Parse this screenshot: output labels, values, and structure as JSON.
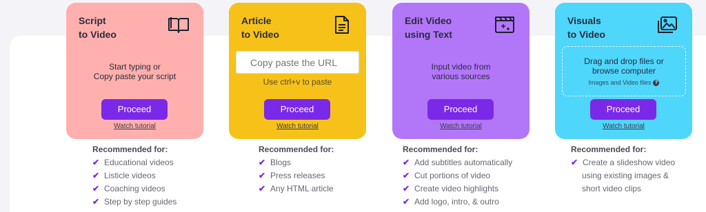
{
  "colors": {
    "card1": "#ffb0ae",
    "card2": "#f6c21a",
    "card3": "#b277f9",
    "card4": "#4fd6fb",
    "accent": "#7b29e8"
  },
  "cards": [
    {
      "title_line1": "Script",
      "title_line2": "to Video",
      "icon": "open-book-icon",
      "desc_line1": "Start typing or",
      "desc_line2": "Copy paste your script",
      "button": "Proceed",
      "tutorial": "Watch tutorial"
    },
    {
      "title_line1": "Article",
      "title_line2": "to Video",
      "icon": "document-icon",
      "input_placeholder": "Copy paste the URL",
      "hint": "Use ctrl+v to paste",
      "button": "Proceed",
      "tutorial": "Watch tutorial"
    },
    {
      "title_line1": "Edit Video",
      "title_line2": "using Text",
      "icon": "film-sparkle-icon",
      "desc_line1": "Input video from",
      "desc_line2": "various sources",
      "button": "Proceed",
      "tutorial": "Watch tutorial"
    },
    {
      "title_line1": "Visuals",
      "title_line2": "to Video",
      "icon": "image-gallery-icon",
      "dropzone_line1": "Drag and drop files or",
      "dropzone_line2": "browse computer",
      "dropzone_sub": "Images and Video files",
      "help_glyph": "?",
      "button": "Proceed",
      "tutorial": "Watch tutorial"
    }
  ],
  "recommended": [
    {
      "title": "Recommended for:",
      "items": [
        "Educational videos",
        "Listicle videos",
        "Coaching videos",
        "Step by step guides"
      ]
    },
    {
      "title": "Recommended for:",
      "items": [
        "Blogs",
        "Press releases",
        "Any HTML article"
      ]
    },
    {
      "title": "Recommended for:",
      "items": [
        "Add subtitles automatically",
        "Cut portions of video",
        "Create video highlights",
        "Add logo, intro, & outro"
      ]
    },
    {
      "title": "Recommended for:",
      "items": [
        "Create a slideshow video"
      ],
      "continuation": [
        "using existing images &",
        "short video clips"
      ]
    }
  ],
  "check_glyph": "✔"
}
